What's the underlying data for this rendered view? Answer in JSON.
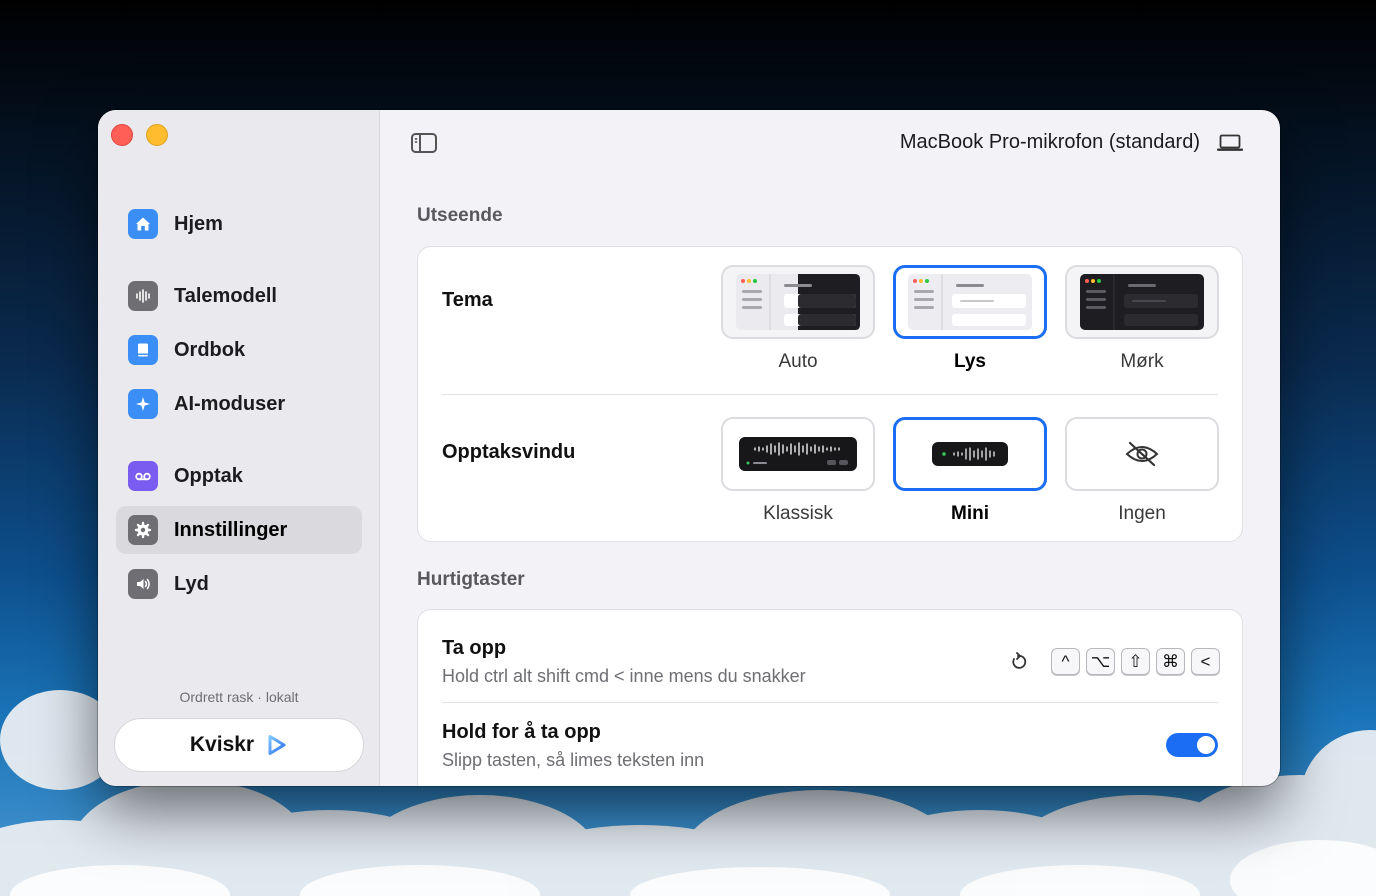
{
  "window": {
    "traffic_lights": [
      "close",
      "minimize"
    ]
  },
  "sidebar": {
    "items": [
      {
        "label": "Hjem",
        "icon": "house-icon",
        "color": "#3a8ef6"
      },
      {
        "label": "Talemodell",
        "icon": "waveform-icon",
        "color": "#6e6e73"
      },
      {
        "label": "Ordbok",
        "icon": "book-icon",
        "color": "#3a8ef6"
      },
      {
        "label": "AI-moduser",
        "icon": "sparkle-icon",
        "color": "#3a8ef6"
      },
      {
        "label": "Opptak",
        "icon": "voicemail-icon",
        "color": "#7a5cf0"
      },
      {
        "label": "Innstillinger",
        "icon": "gear-icon",
        "color": "#6e6e73",
        "active": true
      },
      {
        "label": "Lyd",
        "icon": "speaker-icon",
        "color": "#6e6e73"
      }
    ],
    "tagline": "Ordrett rask · lokalt",
    "brand": "Kviskr"
  },
  "header": {
    "microphone": "MacBook Pro-mikrofon (standard)"
  },
  "appearance": {
    "title": "Utseende",
    "theme": {
      "label": "Tema",
      "options": [
        {
          "label": "Auto",
          "selected": false
        },
        {
          "label": "Lys",
          "selected": true
        },
        {
          "label": "Mørk",
          "selected": false
        }
      ]
    },
    "recording_window": {
      "label": "Opptaksvindu",
      "options": [
        {
          "label": "Klassisk",
          "selected": false
        },
        {
          "label": "Mini",
          "selected": true
        },
        {
          "label": "Ingen",
          "selected": false
        }
      ]
    }
  },
  "shortcuts": {
    "title": "Hurtigtaster",
    "record": {
      "title": "Ta opp",
      "subtitle": "Hold ctrl alt shift cmd < inne mens du snakker",
      "keys": [
        "^",
        "⌥",
        "⇧",
        "⌘",
        "<"
      ]
    },
    "hold_to_record": {
      "title": "Hold for å ta opp",
      "subtitle": "Slipp tasten, så limes teksten inn",
      "enabled": true
    }
  },
  "colors": {
    "accent": "#1b6ef3"
  }
}
